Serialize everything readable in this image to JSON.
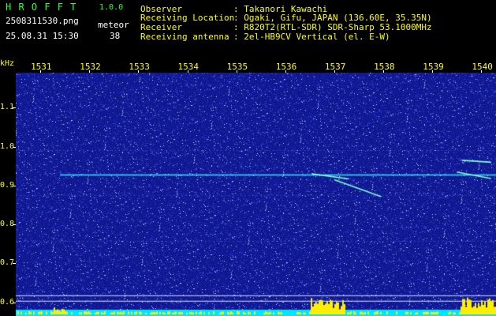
{
  "header": {
    "app_title": "H R O F F T",
    "version": "1.0.0",
    "filename": "2508311530.png",
    "datetime": "25.08.31 15:30",
    "mode_label": "meteor",
    "mode_value": "38",
    "observer_label": "Observer",
    "observer_value": ": Takanori Kawachi",
    "location_label": "Receiving Location",
    "location_value": ": Ogaki, Gifu, JAPAN (136.60E, 35.35N)",
    "receiver_label": "Receiver",
    "receiver_value": ": R820T2(RTL-SDR) SDR-Sharp 53.1000MHz",
    "antenna_label": "Receiving antenna",
    "antenna_value": ": 2el-HB9CV Vertical (el. E-W)"
  },
  "chart_data": {
    "type": "heatmap",
    "ylabel": "kHz",
    "x_ticks": [
      "1531",
      "1532",
      "1533",
      "1534",
      "1535",
      "1536",
      "1537",
      "1538",
      "1539",
      "1540"
    ],
    "y_ticks": [
      "1.1",
      "1.0",
      "0.9",
      "0.8",
      "0.7",
      "0.6"
    ],
    "y_tick_values": [
      1.1,
      1.0,
      0.9,
      0.8,
      0.7,
      0.6
    ],
    "ylim": [
      0.565,
      1.19
    ],
    "xlim": [
      1530.5,
      1540.3
    ],
    "carrier_khz": 0.927,
    "meteor_echoes": [
      {
        "x": [
          1536.55,
          1537.3
        ],
        "y": [
          0.93,
          0.917
        ]
      },
      {
        "x": [
          1537.0,
          1537.95
        ],
        "y": [
          0.915,
          0.872
        ]
      },
      {
        "x": [
          1539.5,
          1540.2
        ],
        "y": [
          0.935,
          0.918
        ]
      },
      {
        "x": [
          1539.6,
          1540.2
        ],
        "y": [
          0.965,
          0.96
        ]
      }
    ],
    "colors": {
      "background": "#121a8c",
      "carrier": "#39e6ff",
      "echo": "#7dffcf",
      "baseline": "#00e5ff",
      "noise_peaks": "#ffee00"
    }
  }
}
